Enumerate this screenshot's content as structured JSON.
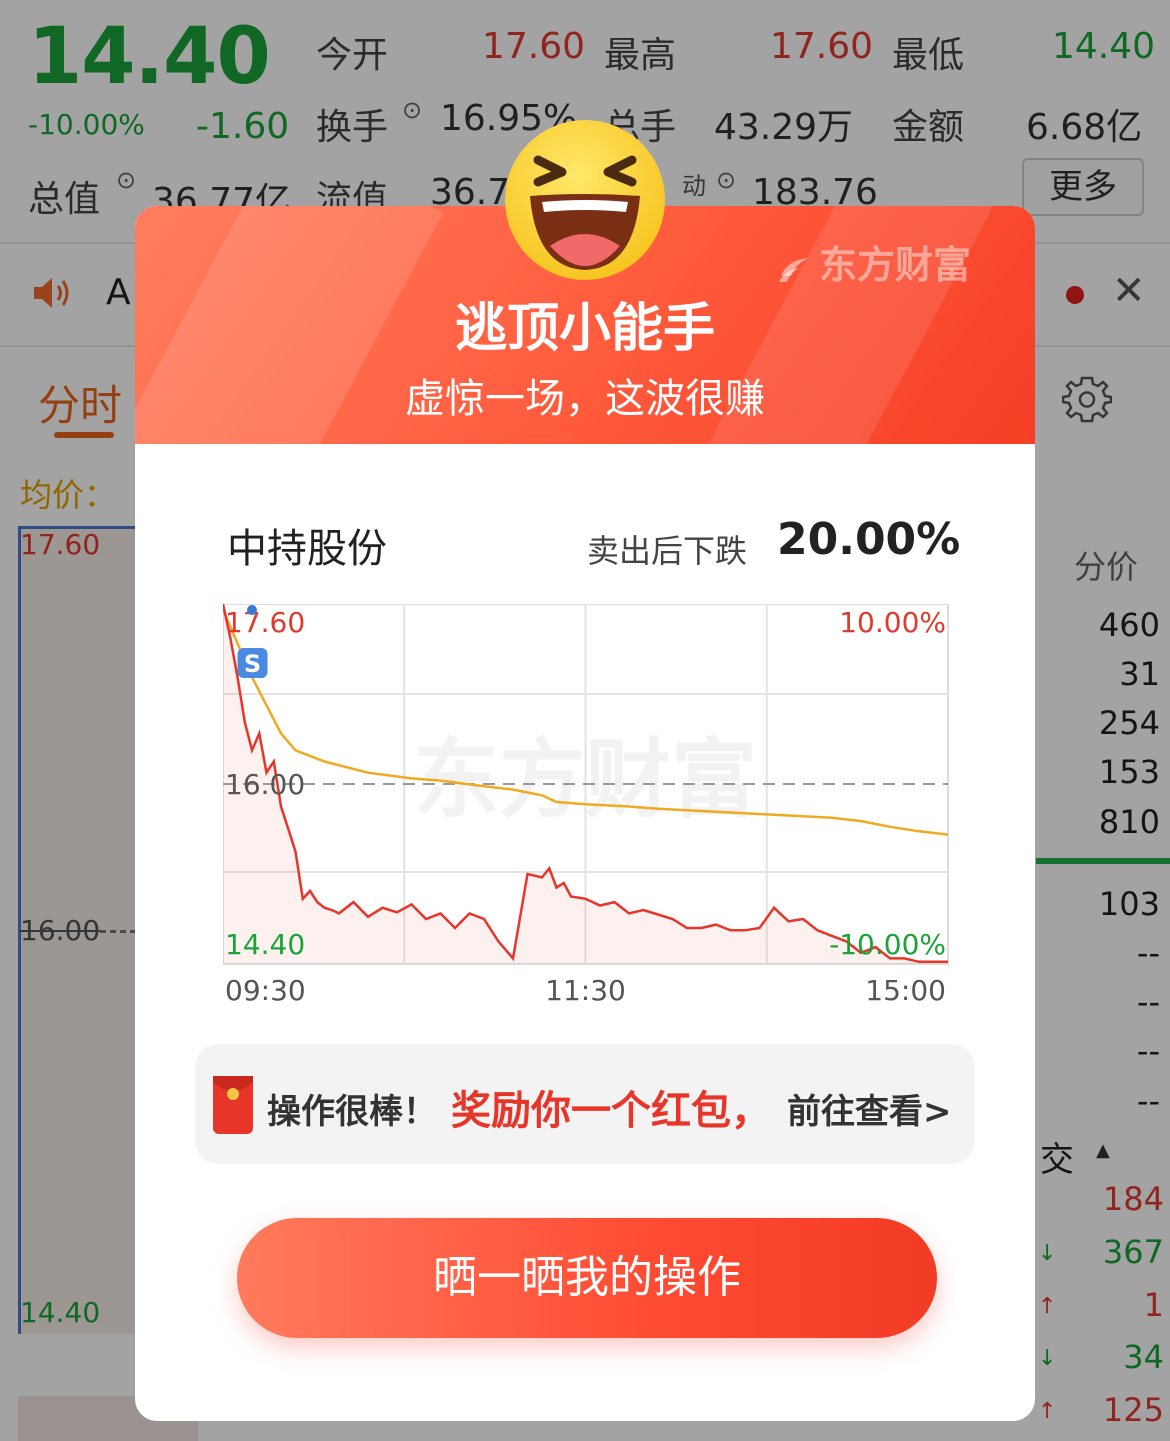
{
  "quote": {
    "price": "14.40",
    "change_pct": "-10.00%",
    "change_amt": "-1.60",
    "open_label": "今开",
    "open_value": "17.60",
    "high_label": "最高",
    "high_value": "17.60",
    "low_label": "最低",
    "low_value": "14.40",
    "turnover_label": "换手",
    "turnover_value": "16.95%",
    "volume_label": "总手",
    "volume_value": "43.29万",
    "amount_label": "金额",
    "amount_value": "6.68亿",
    "total_cap_label": "总值",
    "total_cap_value": "36.77亿",
    "float_cap_label": "流值",
    "float_cap_value": "36.7",
    "pe_label_partial": "动",
    "pe_value": "183.76",
    "more_label": "更多"
  },
  "ticker_bar": {
    "text": "A"
  },
  "tabs": {
    "intraday_label": "分时"
  },
  "chart_bg": {
    "avg_label": "均价：",
    "high": "17.60",
    "mid": "16.00",
    "low": "14.40"
  },
  "right_panel": {
    "header": "分价",
    "values": [
      "460",
      "31",
      "254",
      "153",
      "810"
    ],
    "values2": [
      "103",
      "--",
      "--",
      "--",
      "--"
    ],
    "trade_label": "交",
    "trades": [
      {
        "arrow": "",
        "value": "184",
        "color": "#e03a2f"
      },
      {
        "arrow": "↓",
        "value": "367",
        "color": "#1aa339"
      },
      {
        "arrow": "↑",
        "value": "1",
        "color": "#e03a2f"
      },
      {
        "arrow": "↓",
        "value": "34",
        "color": "#1aa339"
      },
      {
        "arrow": "↑",
        "value": "125",
        "color": "#e03a2f"
      }
    ]
  },
  "popup": {
    "brand": "东方财富",
    "title": "逃顶小能手",
    "subtitle": "虚惊一场，这波很赚",
    "stock_name": "中持股份",
    "drop_label": "卖出后下跌",
    "drop_value": "20.00%",
    "reward_prefix": "操作很棒！",
    "reward_highlight": "奖励你一个红包，",
    "reward_suffix": "前往查看>",
    "share_button": "晒一晒我的操作"
  },
  "chart_data": {
    "type": "line",
    "x_ticks": [
      "09:30",
      "11:30",
      "15:00"
    ],
    "y_left_ticks": [
      "17.60",
      "16.00",
      "14.40"
    ],
    "y_right_ticks": [
      "10.00%",
      "-10.00%"
    ],
    "ylim": [
      14.4,
      17.6
    ],
    "prev_close": 16.0,
    "sell_marker": "S",
    "watermark": "东方财富",
    "colors": {
      "price": "#e8352a",
      "avg": "#f0a920",
      "up": "#e03a2f",
      "down": "#1aa339"
    },
    "series": [
      {
        "key": "price",
        "x": [
          0,
          0.01,
          0.02,
          0.03,
          0.04,
          0.05,
          0.06,
          0.07,
          0.08,
          0.09,
          0.1,
          0.11,
          0.12,
          0.13,
          0.14,
          0.15,
          0.16,
          0.18,
          0.2,
          0.22,
          0.24,
          0.26,
          0.28,
          0.3,
          0.32,
          0.34,
          0.36,
          0.38,
          0.4,
          0.42,
          0.44,
          0.45,
          0.46,
          0.47,
          0.48,
          0.5,
          0.52,
          0.54,
          0.56,
          0.58,
          0.6,
          0.62,
          0.64,
          0.66,
          0.68,
          0.7,
          0.72,
          0.74,
          0.76,
          0.78,
          0.8,
          0.82,
          0.84,
          0.86,
          0.88,
          0.9,
          0.92,
          0.94,
          0.96,
          0.98,
          1.0
        ],
        "y": [
          17.6,
          17.3,
          16.95,
          16.55,
          16.3,
          16.45,
          16.1,
          16.2,
          15.8,
          15.6,
          15.4,
          14.98,
          15.05,
          14.95,
          14.9,
          14.88,
          14.85,
          14.95,
          14.82,
          14.9,
          14.86,
          14.93,
          14.8,
          14.85,
          14.72,
          14.85,
          14.8,
          14.6,
          14.45,
          15.2,
          15.17,
          15.25,
          15.08,
          15.12,
          15.0,
          14.98,
          14.92,
          14.95,
          14.85,
          14.88,
          14.84,
          14.8,
          14.72,
          14.72,
          14.75,
          14.7,
          14.7,
          14.72,
          14.9,
          14.78,
          14.8,
          14.7,
          14.65,
          14.6,
          14.5,
          14.55,
          14.45,
          14.45,
          14.42,
          14.42,
          14.42
        ]
      },
      {
        "key": "avg",
        "x": [
          0,
          0.02,
          0.04,
          0.06,
          0.08,
          0.1,
          0.14,
          0.2,
          0.26,
          0.3,
          0.36,
          0.4,
          0.44,
          0.46,
          0.5,
          0.56,
          0.6,
          0.66,
          0.72,
          0.78,
          0.84,
          0.88,
          0.92,
          0.96,
          1.0
        ],
        "y": [
          17.55,
          17.25,
          16.95,
          16.7,
          16.45,
          16.3,
          16.2,
          16.1,
          16.05,
          16.03,
          15.98,
          15.95,
          15.9,
          15.84,
          15.82,
          15.8,
          15.78,
          15.76,
          15.74,
          15.72,
          15.7,
          15.67,
          15.62,
          15.58,
          15.55
        ]
      }
    ]
  }
}
